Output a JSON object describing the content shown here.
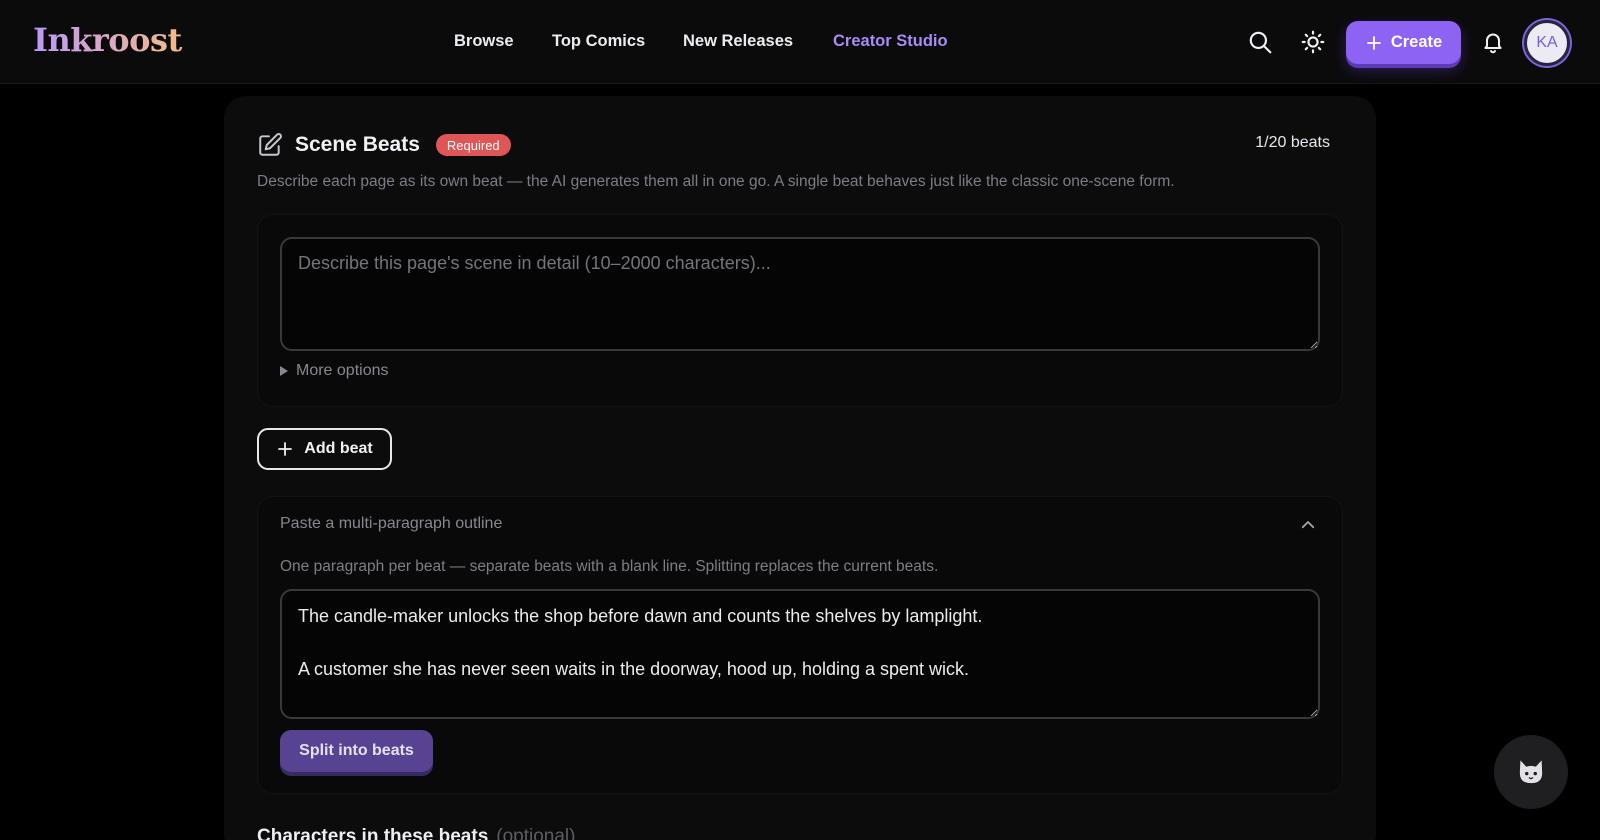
{
  "header": {
    "logo": "Inkroost",
    "nav": [
      {
        "label": "Browse"
      },
      {
        "label": "Top Comics"
      },
      {
        "label": "New Releases"
      },
      {
        "label": "Creator Studio",
        "active": true
      }
    ],
    "icons": [
      "search-icon",
      "sun-icon",
      "bell-icon"
    ],
    "create_label": "Create",
    "avatar_initials": "KA"
  },
  "beats": {
    "title": "Scene Beats",
    "badge": "Required",
    "count": "1/20 beats",
    "description": "Describe each page as its own beat — the AI generates them all in one go. A single beat behaves just like the classic one-scene form.",
    "beat_placeholder": "Describe this page's scene in detail (10–2000 characters)...",
    "beat_value": "",
    "more_options": "More options",
    "add_beat_label": "Add beat"
  },
  "outline": {
    "title": "Paste a multi-paragraph outline",
    "help": "One paragraph per beat — separate beats with a blank line. Splitting replaces the current beats.",
    "value": "The candle-maker unlocks the shop before dawn and counts the shelves by lamplight.\n\nA customer she has never seen waits in the doorway, hood up, holding a spent wick.",
    "split_label": "Split into beats"
  },
  "characters": {
    "title": "Characters in these beats",
    "optional": "(optional)"
  },
  "colors": {
    "accent": "#8d63f3",
    "active_nav": "#a88bf5",
    "required_badge": "#e05555",
    "background": "#000000",
    "card": "#0d0c0d"
  }
}
